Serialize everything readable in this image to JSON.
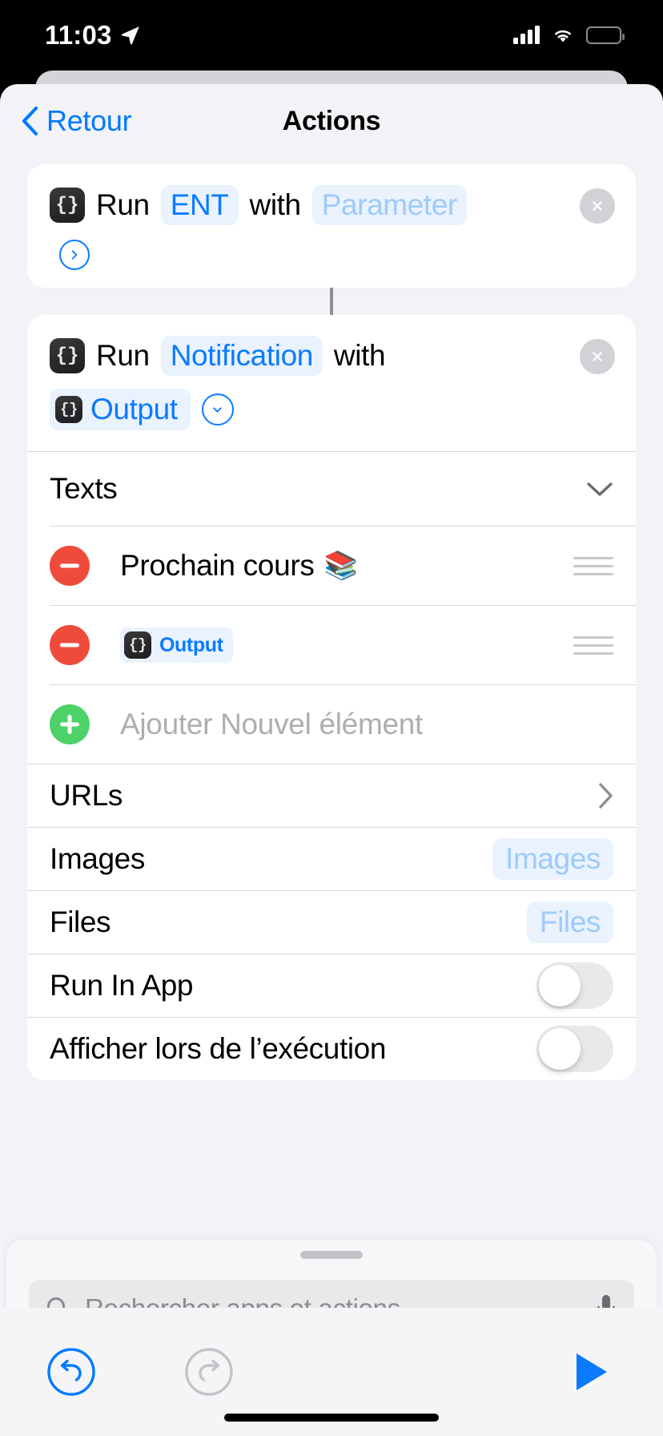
{
  "statusbar": {
    "time": "11:03",
    "location_icon": "location-arrow-icon",
    "signal_icon": "cellular-signal-icon",
    "wifi_icon": "wifi-icon",
    "battery_icon": "battery-low-icon",
    "battery_color": "#f5d000",
    "battery_level_percent": 22
  },
  "navbar": {
    "back_label": "Retour",
    "back_icon": "chevron-left-icon",
    "title": "Actions"
  },
  "colors": {
    "accent_blue": "#007aff",
    "pill_blue_text": "#0a7bff",
    "pill_blue_faded": "#9ecbfb",
    "pill_background": "#eaf2fe",
    "destructive_red": "#ee4b3b",
    "add_green": "#4cd268",
    "sheet_background": "#f2f2f7"
  },
  "actions": [
    {
      "icon": "scriptable-braces-icon",
      "word_run": "Run",
      "script_name": "ENT",
      "word_with": "with",
      "parameter_label": "Parameter",
      "expand_icon": "chevron-right-circle-icon",
      "close_icon": "close-circle-icon"
    },
    {
      "icon": "scriptable-braces-icon",
      "word_run": "Run",
      "script_name": "Notification",
      "word_with": "with",
      "output_icon": "scriptable-braces-icon",
      "output_label": "Output",
      "collapse_icon": "chevron-down-circle-icon",
      "close_icon": "close-circle-icon"
    }
  ],
  "parameters": {
    "texts": {
      "section_label": "Texts",
      "section_toggle_icon": "chevron-down-icon",
      "items": [
        {
          "remove_icon": "minus-circle-icon",
          "text": "Prochain cours",
          "emoji": "📚",
          "reorder_icon": "drag-handle-icon",
          "is_variable": false
        },
        {
          "remove_icon": "minus-circle-icon",
          "variable_icon": "scriptable-braces-icon",
          "text": "Output",
          "reorder_icon": "drag-handle-icon",
          "is_variable": true
        }
      ],
      "add_row": {
        "add_icon": "plus-circle-icon",
        "label": "Ajouter Nouvel élément"
      }
    },
    "rows": [
      {
        "label": "URLs",
        "kind": "disclosure",
        "accessory_icon": "chevron-right-icon",
        "value": ""
      },
      {
        "label": "Images",
        "kind": "pill",
        "value": "Images"
      },
      {
        "label": "Files",
        "kind": "pill",
        "value": "Files"
      },
      {
        "label": "Run In App",
        "kind": "toggle",
        "value": "off"
      },
      {
        "label": "Afficher lors de l’exécution",
        "kind": "toggle",
        "value": "off"
      }
    ]
  },
  "bottom_sheet": {
    "grabber_icon": "sheet-grabber-icon",
    "search": {
      "icon": "search-icon",
      "placeholder": "Rechercher apps et actions",
      "value": "",
      "mic_icon": "microphone-icon"
    }
  },
  "toolbar": {
    "undo_icon": "undo-icon",
    "undo_enabled": true,
    "redo_icon": "redo-icon",
    "redo_enabled": false,
    "play_icon": "play-icon"
  }
}
